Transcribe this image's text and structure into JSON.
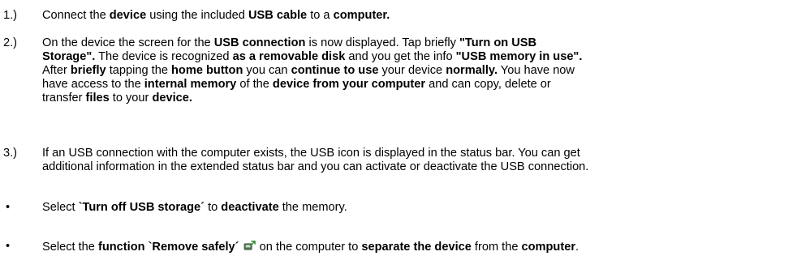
{
  "steps": [
    {
      "number": "1.)",
      "lines": [
        [
          {
            "t": "Connect the "
          },
          {
            "t": "device",
            "b": true
          },
          {
            "t": " using the included "
          },
          {
            "t": "USB cable",
            "b": true
          },
          {
            "t": " to a "
          },
          {
            "t": "computer.",
            "b": true
          }
        ]
      ]
    },
    {
      "number": "2.)",
      "lines": [
        [
          {
            "t": "On the device the screen for the "
          },
          {
            "t": "USB connection",
            "b": true
          },
          {
            "t": " is now displayed. Tap briefly "
          },
          {
            "t": "\"Turn on USB",
            "b": true
          }
        ],
        [
          {
            "t": "Storage\".",
            "b": true
          },
          {
            "t": " The device is recognized "
          },
          {
            "t": "as a removable disk",
            "b": true
          },
          {
            "t": " and you get the info "
          },
          {
            "t": "\"USB memory in use\".",
            "b": true
          }
        ],
        [
          {
            "t": "After "
          },
          {
            "t": "briefly",
            "b": true
          },
          {
            "t": " tapping the "
          },
          {
            "t": "home button",
            "b": true
          },
          {
            "t": " you can "
          },
          {
            "t": "continue to use",
            "b": true
          },
          {
            "t": " your device "
          },
          {
            "t": "normally.",
            "b": true
          },
          {
            "t": " You have now"
          }
        ],
        [
          {
            "t": "have access to the "
          },
          {
            "t": "internal memory",
            "b": true
          },
          {
            "t": " of the "
          },
          {
            "t": "device from your computer",
            "b": true
          },
          {
            "t": " and can copy, delete or"
          }
        ],
        [
          {
            "t": "transfer "
          },
          {
            "t": "files",
            "b": true
          },
          {
            "t": " to your "
          },
          {
            "t": "device.",
            "b": true
          }
        ]
      ]
    },
    {
      "number": "3.)",
      "lines": [
        [
          {
            "t": "If an USB connection with the computer exists, the USB icon is displayed in the status bar. You can get"
          }
        ],
        [
          {
            "t": "additional information in the extended status bar and you can activate or deactivate the USB connection."
          }
        ]
      ]
    }
  ],
  "bullets": [
    {
      "symbol": "•",
      "segments": [
        {
          "t": "Select "
        },
        {
          "t": "`Turn off USB storage´",
          "b": true
        },
        {
          "t": " to "
        },
        {
          "t": "deactivate",
          "b": true
        },
        {
          "t": " the memory."
        }
      ]
    },
    {
      "symbol": "•",
      "segments": [
        {
          "t": "Select the "
        },
        {
          "t": "function `Remove safely´",
          "b": true
        },
        {
          "t": " "
        },
        {
          "icon": "safely-remove-hardware-icon"
        },
        {
          "t": " on the computer to "
        },
        {
          "t": "separate the device",
          "b": true
        },
        {
          "t": " from the "
        },
        {
          "t": "computer",
          "b": true
        },
        {
          "t": "."
        }
      ]
    }
  ],
  "icon_colors": {
    "device_body": "#4a7a4a",
    "arrow": "#2e8b2e",
    "outline": "#555555"
  }
}
